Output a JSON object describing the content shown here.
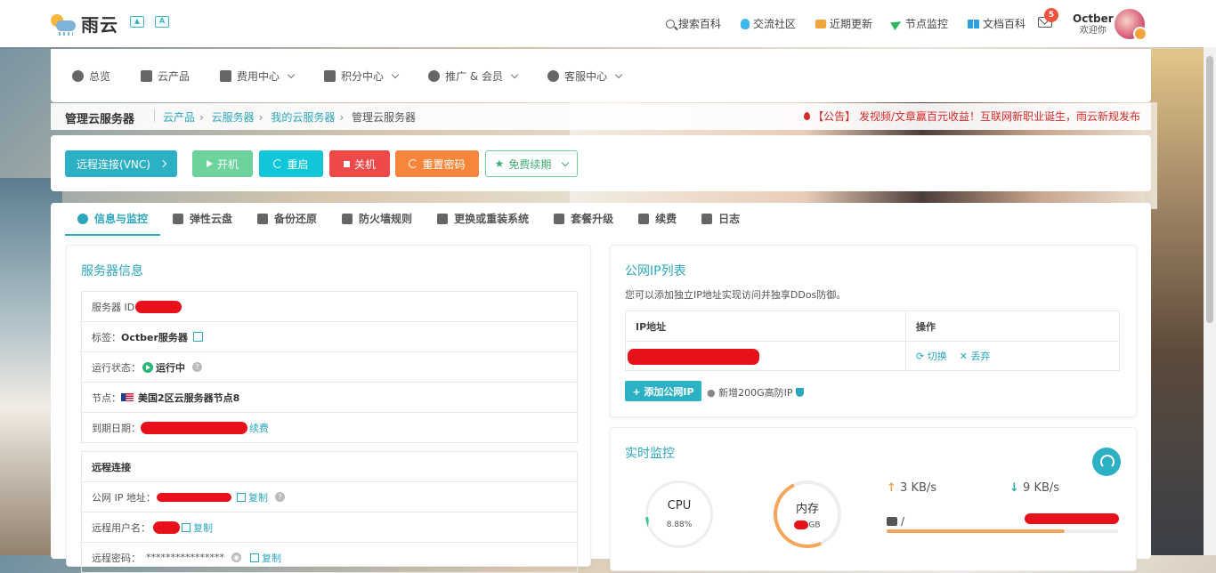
{
  "header": {
    "logo_text": "雨云",
    "nav": [
      {
        "label": "搜索百科",
        "icon": "search-icon"
      },
      {
        "label": "交流社区",
        "icon": "qq-icon"
      },
      {
        "label": "近期更新",
        "icon": "news-icon"
      },
      {
        "label": "节点监控",
        "icon": "plane-icon"
      },
      {
        "label": "文档百科",
        "icon": "book-icon"
      }
    ],
    "mail_badge": "5",
    "user_name": "Octber",
    "user_greeting": "欢迎你"
  },
  "menu": {
    "items": [
      {
        "label": "总览",
        "dropdown": false
      },
      {
        "label": "云产品",
        "dropdown": false
      },
      {
        "label": "费用中心",
        "dropdown": true
      },
      {
        "label": "积分中心",
        "dropdown": true
      },
      {
        "label": "推广 & 会员",
        "dropdown": true
      },
      {
        "label": "客服中心",
        "dropdown": true
      }
    ]
  },
  "breadcrumb": {
    "title": "管理云服务器",
    "trail": [
      "云产品",
      "云服务器",
      "我的云服务器"
    ],
    "current": "管理云服务器",
    "notice": "【公告】 发视频/文章赢百元收益！互联网新职业诞生，雨云新规发布"
  },
  "actions": {
    "vnc": "远程连接(VNC)",
    "power_on": "开机",
    "restart": "重启",
    "shutdown": "关机",
    "reset_password": "重置密码",
    "free_renew": "免费续期"
  },
  "tabs": [
    {
      "label": "信息与监控",
      "active": true
    },
    {
      "label": "弹性云盘",
      "active": false
    },
    {
      "label": "备份还原",
      "active": false
    },
    {
      "label": "防火墙规则",
      "active": false
    },
    {
      "label": "更换或重装系统",
      "active": false
    },
    {
      "label": "套餐升级",
      "active": false
    },
    {
      "label": "续费",
      "active": false
    },
    {
      "label": "日志",
      "active": false
    }
  ],
  "server_info": {
    "heading": "服务器信息",
    "id_label": "服务器 ID",
    "tag_label": "标签：",
    "tag_value": "Octber服务器",
    "status_label": "运行状态：",
    "status_value": "运行中",
    "node_label": "节点：",
    "node_value": "美国2区云服务器节点8",
    "expire_label": "到期日期：",
    "renew_link": "续费",
    "remote_heading": "远程连接",
    "public_ip_label": "公网 IP 地址：",
    "copy": "复制",
    "remote_user_label": "远程用户名：",
    "remote_pwd_label": "远程密码：",
    "remote_pwd_value": "****************"
  },
  "ip_list": {
    "heading": "公网IP列表",
    "desc": "您可以添加独立IP地址实现访问并独享DDos防御。",
    "col_ip": "IP地址",
    "col_op": "操作",
    "op_switch": "切换",
    "op_discard": "丢弃",
    "add_btn": "+ 添加公网IP",
    "add_note": "新增200G高防IP"
  },
  "monitor": {
    "heading": "实时监控",
    "cpu_label": "CPU",
    "cpu_value": "8.88%",
    "cpu_percent": 8.88,
    "mem_label": "内存",
    "mem_value_suffix": "GB",
    "upload": "3 KB/s",
    "download": "9 KB/s",
    "disk_mount": "/"
  },
  "colors": {
    "accent": "#2aa6bd",
    "danger": "#ef4a4a",
    "warning": "#f6873a",
    "success": "#6bd39b"
  }
}
